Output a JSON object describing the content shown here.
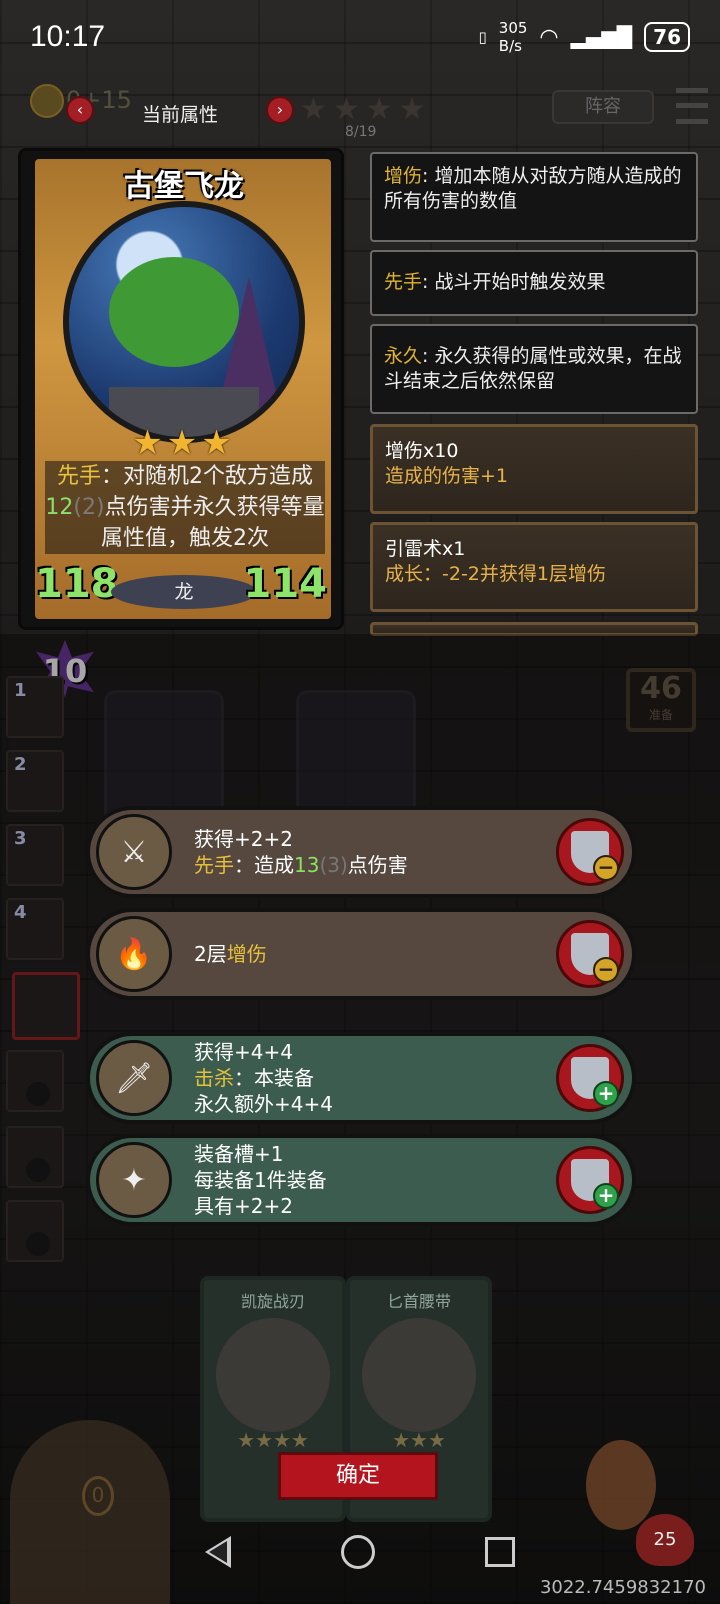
{
  "status_bar": {
    "time": "10:17",
    "net_speed": "305",
    "net_unit": "B/s",
    "battery": "76"
  },
  "header": {
    "tab_title": "当前属性",
    "progress": "8/19",
    "team_label": "阵容",
    "gold": "0+15"
  },
  "card": {
    "name": "古堡飞龙",
    "stars": "★★★",
    "desc_kw": "先手",
    "desc_a": "：对随机",
    "desc_num1": "2",
    "desc_b": "个敌方造成",
    "desc_dmg": "12",
    "desc_base": "(2)",
    "desc_c": "点伤害并永久获得等量属性值，触发",
    "desc_num2": "2",
    "desc_d": "次",
    "attack": "118",
    "health": "114",
    "tribe": "龙"
  },
  "keywords": [
    {
      "k": "增伤",
      "text": ": 增加本随从对敌方随从造成的所有伤害的数值"
    },
    {
      "k": "先手",
      "text": ": 战斗开始时触发效果"
    },
    {
      "k": "永久",
      "text": ": 永久获得的属性或效果，在战斗结束之后依然保留"
    }
  ],
  "equipment": [
    {
      "title": "增伤x10",
      "sub": "造成的伤害+1"
    },
    {
      "title": "引雷术x1",
      "sub": "成长：-2-2并获得1层增伤"
    }
  ],
  "level": "10",
  "deck": {
    "count": "46",
    "label": "准备"
  },
  "side_slots": [
    "1",
    "2",
    "3",
    "4"
  ],
  "options": [
    {
      "line1": "获得+2+2",
      "kw": "先手",
      "mid": "：造成",
      "num": "13",
      "dim": "(3)",
      "tail": "点伤害"
    },
    {
      "num_pre": "2层",
      "kw": "增伤"
    },
    {
      "line1": "获得+4+4",
      "kw": "击杀",
      "mid": "：本装备",
      "line3": "永久额外+4+4"
    },
    {
      "line1": "装备槽+1",
      "line2": "每装备1件装备",
      "line3": "具有+2+2"
    }
  ],
  "rewards": [
    {
      "name": "凯旋战刃"
    },
    {
      "name": "匕首腰带"
    }
  ],
  "confirm_label": "确定",
  "hero_hp": "25",
  "door_label": "0",
  "coords": "3022.7459832170"
}
